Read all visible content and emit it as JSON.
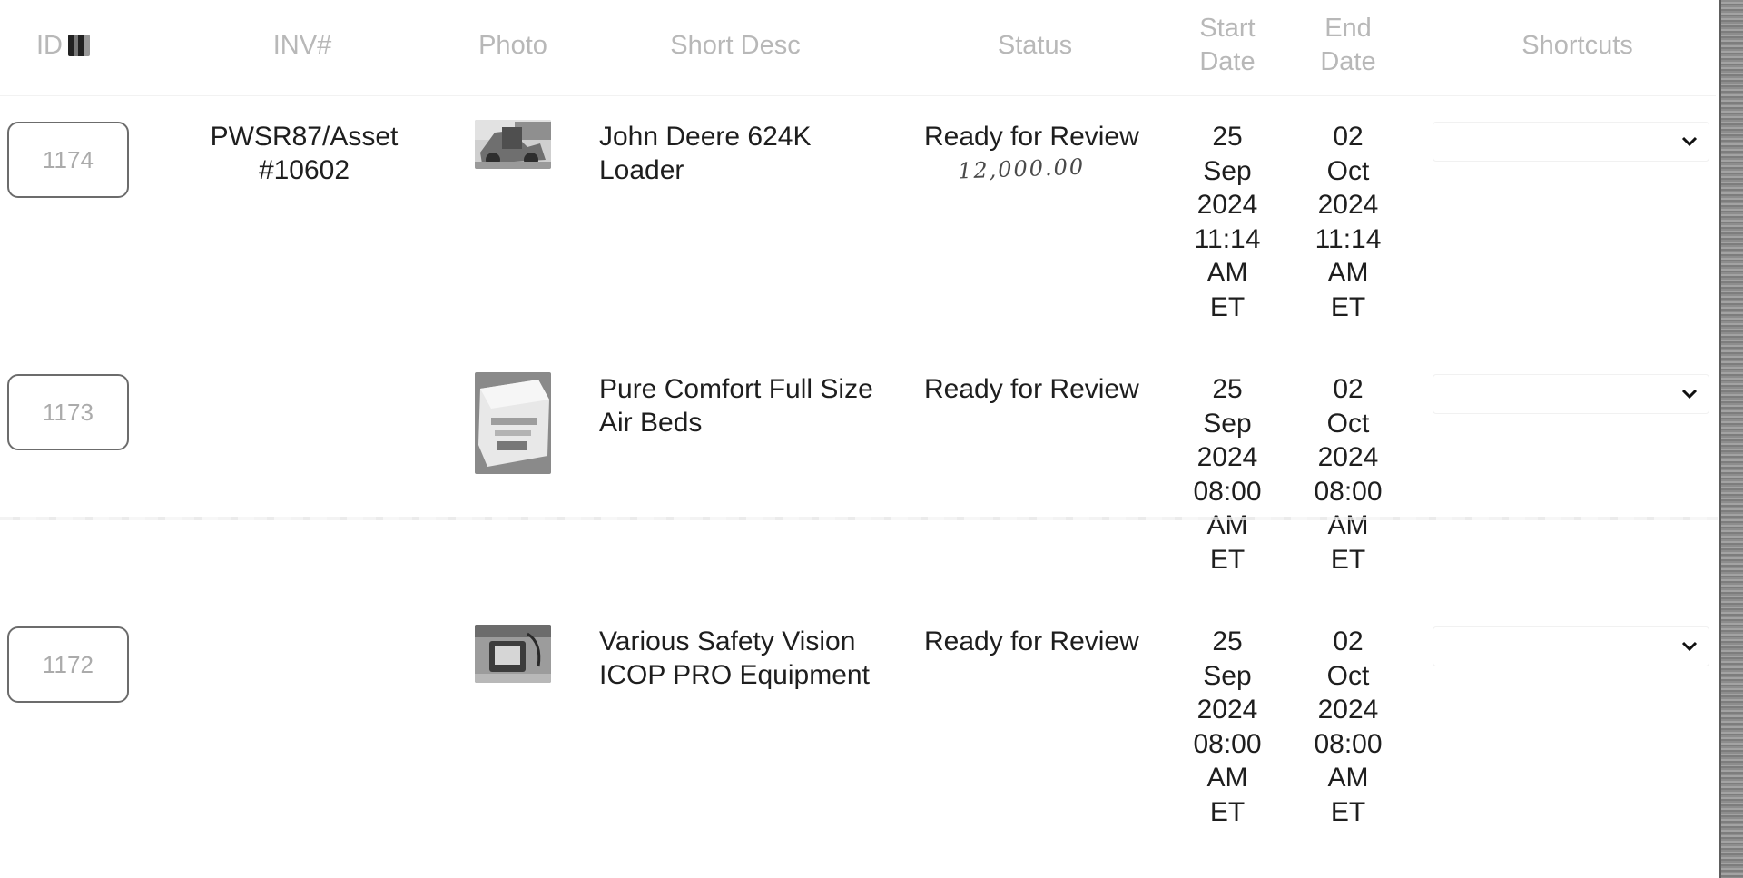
{
  "table": {
    "columns": {
      "id": "ID",
      "inv": "INV#",
      "photo": "Photo",
      "desc": "Short Desc",
      "status": "Status",
      "start_date": "Start Date",
      "end_date": "End Date",
      "shortcuts": "Shortcuts"
    },
    "rows": [
      {
        "id": "1174",
        "inv": "PWSR87/Asset #10602",
        "desc": "John Deere 624K Loader",
        "status": "Ready for Review",
        "note": "12,000.00",
        "start": [
          "25",
          "Sep",
          "2024",
          "11:14",
          "AM",
          "ET"
        ],
        "end": [
          "02",
          "Oct",
          "2024",
          "11:14",
          "AM",
          "ET"
        ]
      },
      {
        "id": "1173",
        "inv": "",
        "desc": "Pure Comfort Full Size Air Beds",
        "status": "Ready for Review",
        "start": [
          "25",
          "Sep",
          "2024",
          "08:00",
          "AM",
          "ET"
        ],
        "end": [
          "02",
          "Oct",
          "2024",
          "08:00",
          "AM",
          "ET"
        ]
      },
      {
        "id": "1172",
        "inv": "",
        "desc": "Various Safety Vision ICOP PRO Equipment",
        "status": "Ready for Review",
        "start": [
          "25",
          "Sep",
          "2024",
          "08:00",
          "AM",
          "ET"
        ],
        "end": [
          "02",
          "Oct",
          "2024",
          "08:00",
          "AM",
          "ET"
        ]
      }
    ]
  },
  "icons": {
    "sort": "sort-icon",
    "dropdown": "chevron-down-icon"
  },
  "colors": {
    "header_text": "#b8b8b8",
    "body_text": "#1e1e1e",
    "id_border": "#6c6c6c",
    "id_text": "#ababab"
  }
}
